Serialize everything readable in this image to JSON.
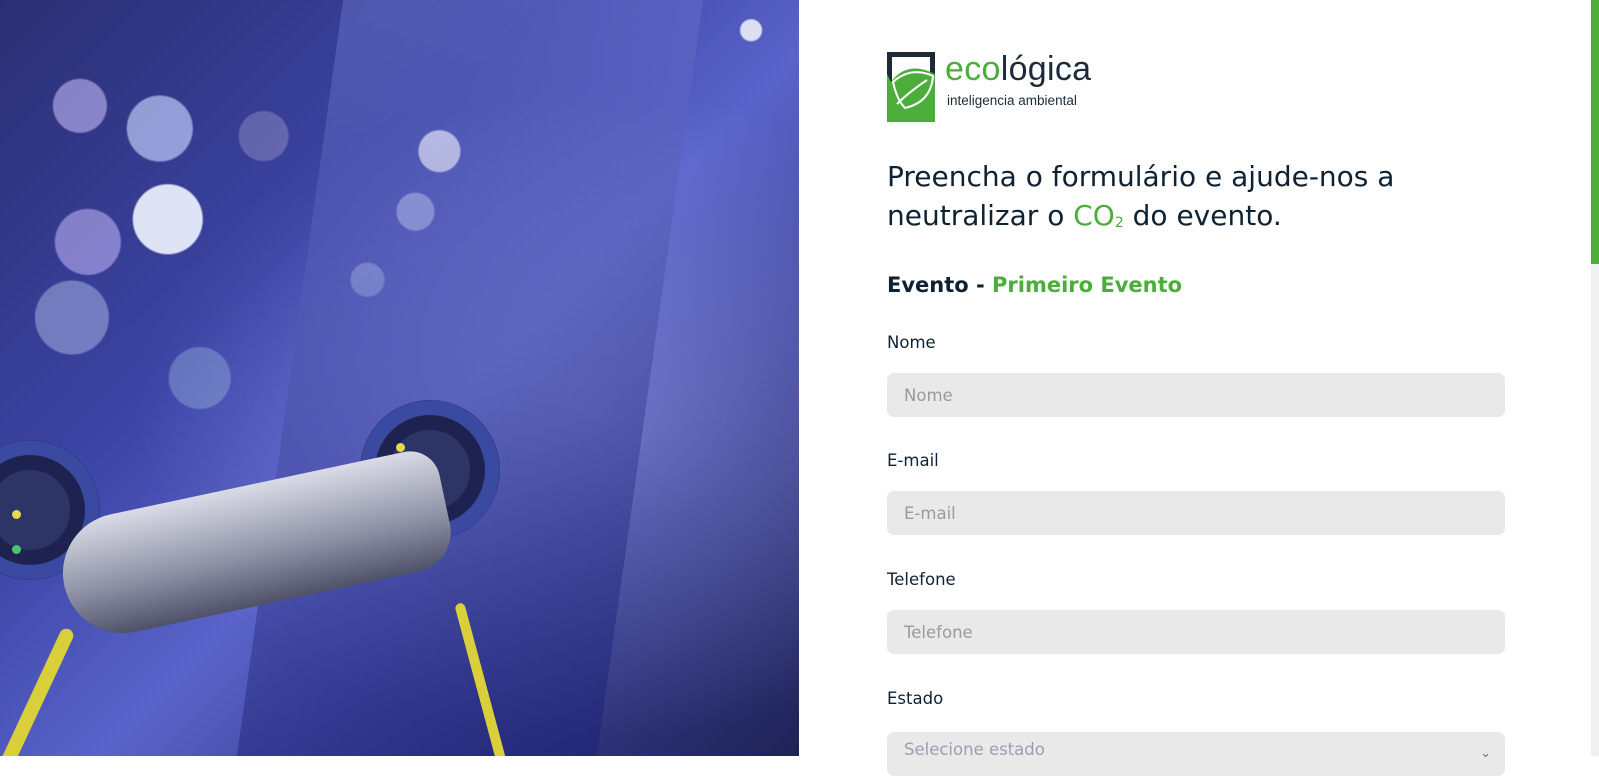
{
  "logo": {
    "name_part1": "eco",
    "name_part2": "lógica",
    "tagline": "inteligencia ambiental"
  },
  "headline": {
    "part1": "Preencha o formulário e ajude-nos a neutralizar o ",
    "co2_main": "CO",
    "co2_sub": "2",
    "part2": " do evento."
  },
  "event": {
    "prefix": "Evento - ",
    "name": "Primeiro Evento"
  },
  "form": {
    "nome": {
      "label": "Nome",
      "placeholder": "Nome",
      "value": ""
    },
    "email": {
      "label": "E-mail",
      "placeholder": "E-mail",
      "value": ""
    },
    "telefone": {
      "label": "Telefone",
      "placeholder": "Telefone",
      "value": ""
    },
    "estado": {
      "label": "Estado",
      "selected": "Selecione estado"
    }
  },
  "colors": {
    "accent": "#4cae3a",
    "text": "#0f2233",
    "input_bg": "#e9e9e9"
  },
  "icons": {
    "logo": "leaf-logo-icon",
    "select": "chevron-down-icon"
  }
}
